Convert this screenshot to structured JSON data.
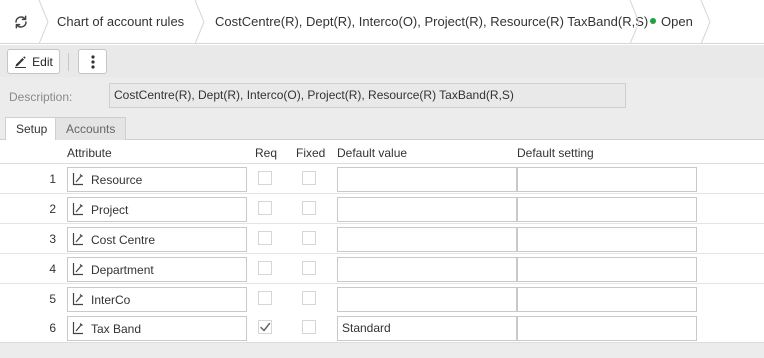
{
  "breadcrumb": {
    "refresh_icon": "refresh-icon",
    "items": [
      "Chart of account rules",
      "CostCentre(R), Dept(R), Interco(O), Project(R), Resource(R) TaxBand(R,S)",
      "Open"
    ],
    "status_color": "#1fa33c"
  },
  "toolbar": {
    "edit_label": "Edit",
    "edit_icon": "pencil-icon",
    "more_icon": "kebab-menu-icon"
  },
  "description": {
    "label": "Description:",
    "value": "CostCentre(R), Dept(R), Interco(O), Project(R), Resource(R) TaxBand(R,S)"
  },
  "tabs": [
    {
      "label": "Setup",
      "active": true
    },
    {
      "label": "Accounts",
      "active": false
    }
  ],
  "grid": {
    "columns": {
      "attribute": "Attribute",
      "req": "Req",
      "fixed": "Fixed",
      "default_value": "Default value",
      "default_setting": "Default setting"
    },
    "attribute_icon": "edit-attribute-icon",
    "rows": [
      {
        "num": "1",
        "attribute": "Resource",
        "req": false,
        "fixed": false,
        "default_value": "",
        "default_setting": ""
      },
      {
        "num": "2",
        "attribute": "Project",
        "req": false,
        "fixed": false,
        "default_value": "",
        "default_setting": ""
      },
      {
        "num": "3",
        "attribute": "Cost Centre",
        "req": false,
        "fixed": false,
        "default_value": "",
        "default_setting": ""
      },
      {
        "num": "4",
        "attribute": "Department",
        "req": false,
        "fixed": false,
        "default_value": "",
        "default_setting": ""
      },
      {
        "num": "5",
        "attribute": "InterCo",
        "req": false,
        "fixed": false,
        "default_value": "",
        "default_setting": ""
      },
      {
        "num": "6",
        "attribute": "Tax Band",
        "req": true,
        "fixed": false,
        "default_value": "Standard",
        "default_setting": ""
      }
    ]
  }
}
